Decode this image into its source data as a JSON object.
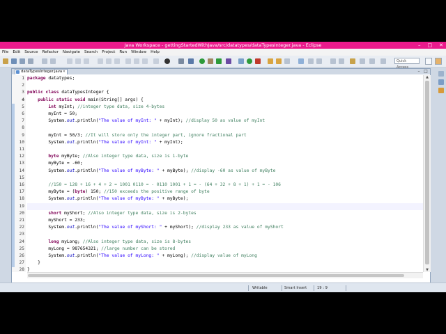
{
  "window": {
    "title": "Java Workspace - gettingStartedWithJava/src/datatypes/dataTypesInteger.java - Eclipse",
    "controls": [
      "–",
      "□",
      "✕"
    ]
  },
  "menu": [
    "File",
    "Edit",
    "Source",
    "Refactor",
    "Navigate",
    "Search",
    "Project",
    "Run",
    "Window",
    "Help"
  ],
  "toolbar": {
    "quick_access_placeholder": "Quick Access"
  },
  "editor": {
    "tab_label": "dataTypesInteger.java",
    "tab_close": "✕"
  },
  "code_lines": [
    {
      "n": "1",
      "fold": "",
      "text": "package datatypes;"
    },
    {
      "n": "2",
      "fold": "",
      "text": ""
    },
    {
      "n": "3",
      "fold": "",
      "text": "public class dataTypesInteger {"
    },
    {
      "n": "4",
      "fold": "⊖",
      "text": "    public static void main(String[] args) {"
    },
    {
      "n": "5",
      "fold": "",
      "text": "        int myInt; //integer type data, size 4-bytes"
    },
    {
      "n": "6",
      "fold": "",
      "text": "        myInt = 50;"
    },
    {
      "n": "7",
      "fold": "",
      "text": "        System.out.println(\"The value of myInt: \" + myInt); //display 50 as value of myInt"
    },
    {
      "n": "8",
      "fold": "",
      "text": ""
    },
    {
      "n": "9",
      "fold": "",
      "text": "        myInt = 50/3; //It will store only the integer part, ignore fractional part"
    },
    {
      "n": "10",
      "fold": "",
      "text": "        System.out.println(\"The value of myInt: \" + myInt);"
    },
    {
      "n": "11",
      "fold": "",
      "text": ""
    },
    {
      "n": "12",
      "fold": "",
      "text": "        byte myByte; //Also integer type data, size is 1-byte"
    },
    {
      "n": "13",
      "fold": "",
      "text": "        myByte = -60;"
    },
    {
      "n": "14",
      "fold": "",
      "text": "        System.out.println(\"The value of myByte: \" + myByte); //display -60 as value of myByte"
    },
    {
      "n": "15",
      "fold": "",
      "text": ""
    },
    {
      "n": "16",
      "fold": "",
      "text": "        //150 = 128 + 16 + 4 + 2 = 1001 0110 = - 0110 1001 + 1 = - (64 + 32 + 8 + 1) + 1 = - 106"
    },
    {
      "n": "17",
      "fold": "",
      "text": "        myByte = (byte) 150; //150 exceeds the positive range of byte"
    },
    {
      "n": "18",
      "fold": "",
      "text": "        System.out.println(\"The value of myByte: \" + myByte);"
    },
    {
      "n": "19",
      "fold": "",
      "text": ""
    },
    {
      "n": "20",
      "fold": "",
      "text": "        short myShort; //Also integer type data, size is 2-bytes"
    },
    {
      "n": "21",
      "fold": "",
      "text": "        myShort = 233;"
    },
    {
      "n": "22",
      "fold": "",
      "text": "        System.out.println(\"The value of myShort: \" + myShort); //display 233 as value of myShort"
    },
    {
      "n": "23",
      "fold": "",
      "text": ""
    },
    {
      "n": "24",
      "fold": "",
      "text": "        long myLong; //Also integer type data, size is 8-bytes"
    },
    {
      "n": "25",
      "fold": "",
      "text": "        myLong = 987654321; //large number can be stored"
    },
    {
      "n": "26",
      "fold": "",
      "text": "        System.out.println(\"The value of myLong: \" + myLong); //display value of myLong"
    },
    {
      "n": "27",
      "fold": "",
      "text": "    }"
    },
    {
      "n": "28",
      "fold": "",
      "text": "}"
    }
  ],
  "current_line": "19",
  "status": {
    "writable": "Writable",
    "insert_mode": "Smart Insert",
    "position": "19 : 9"
  },
  "colors": {
    "titlebar": "#eb1a8c",
    "keyword": "#7f0055",
    "comment": "#3f7f5f",
    "string": "#2a00ff",
    "field": "#0000c0"
  }
}
